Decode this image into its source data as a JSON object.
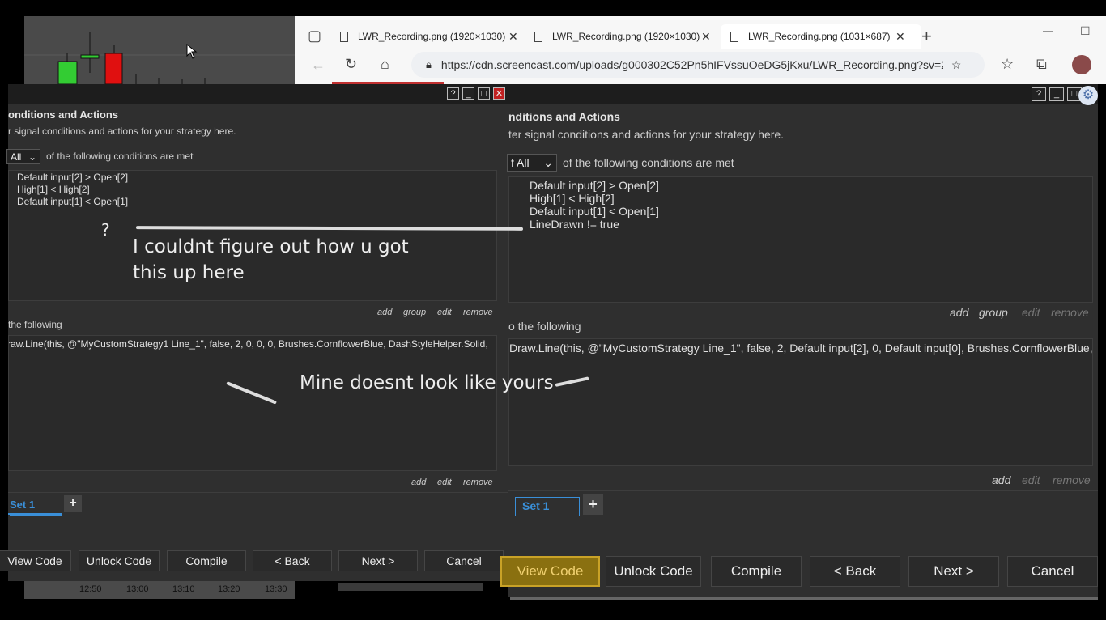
{
  "chart": {
    "times": [
      "12:50",
      "13:00",
      "13:10",
      "13:20",
      "13:30"
    ],
    "bull_color": "#33cc33",
    "bear_color": "#e01010"
  },
  "browser": {
    "tabs": [
      {
        "title": "LWR_Recording.png (1920×1030)"
      },
      {
        "title": "LWR_Recording.png (1920×1030)"
      },
      {
        "title": "LWR_Recording.png (1031×687)"
      }
    ],
    "url": "https://cdn.screencast.com/uploads/g000302C52Pn5hIFVssuOeDG5jKxu/LWR_Recording.png?sv=2...",
    "new_tab": "+",
    "minimize": "—",
    "maximize": "☐"
  },
  "left": {
    "title_buttons": [
      "?",
      "_",
      "□",
      "✕"
    ],
    "heading": "onditions and Actions",
    "subtitle": "r signal conditions and actions for your strategy here.",
    "match_value": "All",
    "match_suffix": "of the following conditions are met",
    "conditions": [
      "Default input[2] > Open[2]",
      "High[1] < High[2]",
      "Default input[1] < Open[1]"
    ],
    "cond_links": [
      "add",
      "group",
      "edit",
      "remove"
    ],
    "actions_label": "the following",
    "action": "raw.Line(this, @\"MyCustomStrategy1 Line_1\", false, 2, 0, 0, 0, Brushes.CornflowerBlue, DashStyleHelper.Solid,",
    "action_links": [
      "add",
      "edit",
      "remove"
    ],
    "set_tab": "Set 1",
    "add_set": "+",
    "buttons": [
      "View Code",
      "Unlock Code",
      "Compile",
      "< Back",
      "Next >",
      "Cancel"
    ]
  },
  "right": {
    "title_buttons": [
      "?",
      "_",
      "□"
    ],
    "heading": "nditions and Actions",
    "subtitle": "ter signal conditions and actions for your strategy here.",
    "match_value": "f All",
    "match_suffix": "of the following conditions are met",
    "conditions": [
      "Default input[2] > Open[2]",
      "High[1] < High[2]",
      "Default input[1] < Open[1]",
      "LineDrawn != true"
    ],
    "cond_links": [
      "add",
      "group",
      "edit",
      "remove"
    ],
    "actions_label": "o the following",
    "action": "Draw.Line(this, @\"MyCustomStrategy Line_1\", false, 2, Default input[2], 0, Default input[0], Brushes.CornflowerBlue, Das",
    "action_links": [
      "add",
      "edit",
      "remove"
    ],
    "set_tab": "Set 1",
    "add_set": "+",
    "buttons": [
      "View Code",
      "Unlock Code",
      "Compile",
      "< Back",
      "Next >",
      "Cancel"
    ],
    "highlight_color": "#c9a227"
  },
  "annotations": {
    "question": "?",
    "note1_line1": "I couldnt figure out how u got",
    "note1_line2": "this up here",
    "note2": "Mine doesnt look like yours"
  }
}
